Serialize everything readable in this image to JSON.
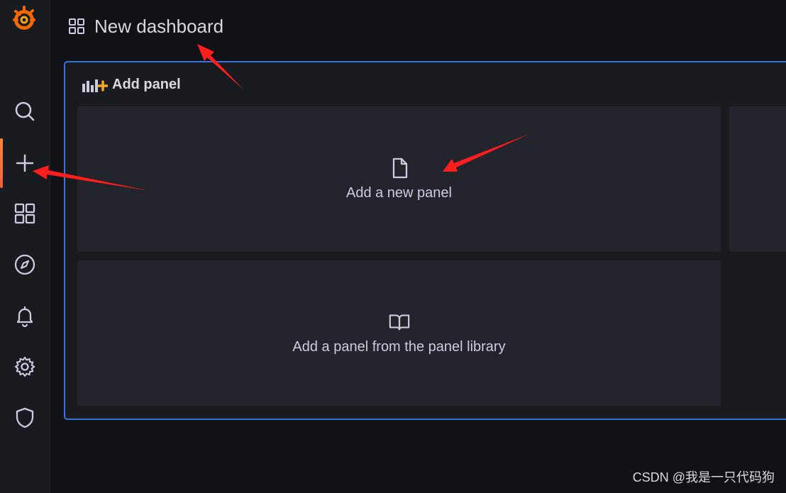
{
  "topbar": {
    "title": "New dashboard"
  },
  "panel": {
    "header": "Add panel",
    "cards": {
      "new_panel": "Add a new panel",
      "library_panel": "Add a panel from the panel library"
    }
  },
  "sidebar": {
    "items": [
      {
        "icon": "search-icon"
      },
      {
        "icon": "plus-icon",
        "active": true
      },
      {
        "icon": "dashboards-icon"
      },
      {
        "icon": "compass-icon"
      },
      {
        "icon": "bell-icon"
      },
      {
        "icon": "gear-icon"
      },
      {
        "icon": "shield-icon"
      }
    ]
  },
  "watermark": "CSDN @我是一只代码狗",
  "colors": {
    "accent_border": "#3d71d9",
    "active_indicator": "#f55f3e",
    "annotation_arrow": "#ff1d1d"
  }
}
